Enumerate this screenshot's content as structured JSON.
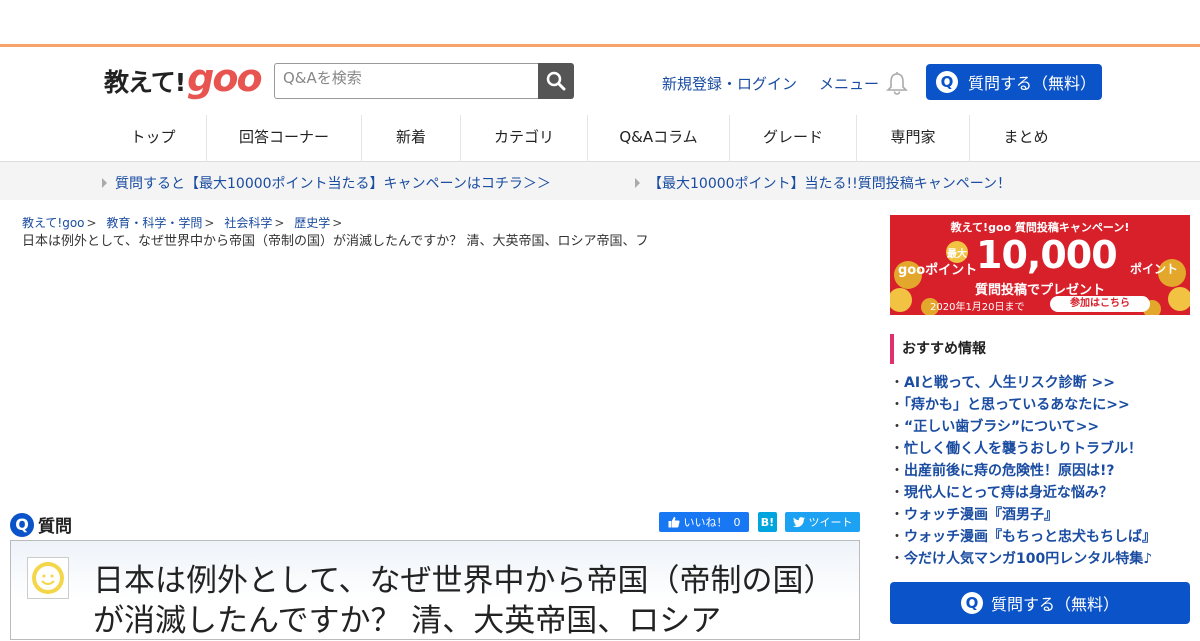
{
  "header": {
    "logo_text": "教えて!",
    "logo_goo": "goo",
    "search_placeholder": "Q&Aを検索",
    "login_link": "新規登録・ログイン",
    "menu_link": "メニュー",
    "ask_button": "質問する（無料）"
  },
  "nav": {
    "items": [
      "トップ",
      "回答コーナー",
      "新着",
      "カテゴリ",
      "Q&Aコラム",
      "グレード",
      "専門家",
      "まとめ"
    ]
  },
  "campaign": {
    "link1": "質問すると【最大10000ポイント当たる】キャンペーンはコチラ＞＞",
    "link2": "【最大10000ポイント】当たる!!質問投稿キャンペーン！"
  },
  "breadcrumb": {
    "items": [
      "教えて!goo",
      "教育・科学・学問",
      "社会科学",
      "歴史学"
    ],
    "sep": ">",
    "current": "日本は例外として、なぜ世界中から帝国（帝制の国）が消滅したんですか？ 清、大英帝国、ロシア帝国、フ"
  },
  "question": {
    "heading": "質問",
    "q_icon": "Q",
    "like_label": "いいね！",
    "like_count": "0",
    "hatena_label": "B!",
    "tweet_label": "ツイート",
    "title": "日本は例外として、なぜ世界中から帝国（帝制の国）が消滅したんですか？ 清、大英帝国、ロシア"
  },
  "banner": {
    "top": "教えて!goo 質問投稿キャンペーン!",
    "pre": "gooポイント",
    "max": "最大",
    "amount": "10,000",
    "unit": "ポイント",
    "sub": "質問投稿でプレゼント",
    "deadline": "2020年1月20日まで",
    "cta": "参加はこちら"
  },
  "recommend": {
    "heading": "おすすめ情報",
    "items": [
      "AIと戦って、人生リスク診断 >>",
      "「痔かも」と思っているあなたに>>",
      "“正しい歯ブラシ”について>>",
      "忙しく働く人を襲うおしりトラブル！",
      "出産前後に痔の危険性！原因は!?",
      "現代人にとって痔は身近な悩み？",
      "ウォッチ漫画『酒男子』",
      "ウォッチ漫画『もちっと忠犬もちしば』",
      "今だけ人気マンガ100円レンタル特集♪"
    ],
    "ask_button": "質問する（無料）"
  },
  "colors": {
    "brand_blue": "#0b53c8",
    "link_blue": "#1a4ca1",
    "goo_red": "#e8544f",
    "accent_orange": "#f5a36a",
    "rec_bar": "#e0316d"
  }
}
